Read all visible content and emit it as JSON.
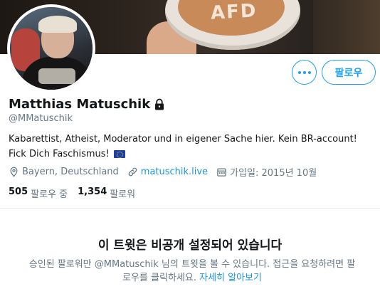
{
  "banner": {
    "text": "AFD"
  },
  "actions": {
    "follow_label": "팔로우"
  },
  "profile": {
    "name": "Matthias Matuschik",
    "handle": "@MMatuschik",
    "bio": "Kabarettist, Atheist, Moderator und in eigener Sache hier. Kein BR-account! Fick Dich Faschismus!",
    "location": "Bayern, Deutschland",
    "website": "matuschik.live",
    "joined": "가입일: 2015년 10월"
  },
  "stats": {
    "following_count": "505",
    "following_label": "팔로우 중",
    "followers_count": "1,354",
    "followers_label": "팔로워"
  },
  "private_notice": {
    "title": "이 트윗은 비공개 설정되어 있습니다",
    "desc_before": "승인된 팔로워만 @MMatuschik 님의 트윗을 볼 수 있습니다. 접근을 요청하려면 팔로우를 클릭하세요.",
    "link": "자세히 알아보기"
  },
  "colors": {
    "accent": "#1da1f2",
    "link": "#1b95e0",
    "secondary_text": "#657786",
    "primary_text": "#14171a"
  },
  "icons": [
    "more-dots-icon",
    "lock-icon",
    "location-pin-icon",
    "link-icon",
    "calendar-icon",
    "eu-flag-icon"
  ]
}
